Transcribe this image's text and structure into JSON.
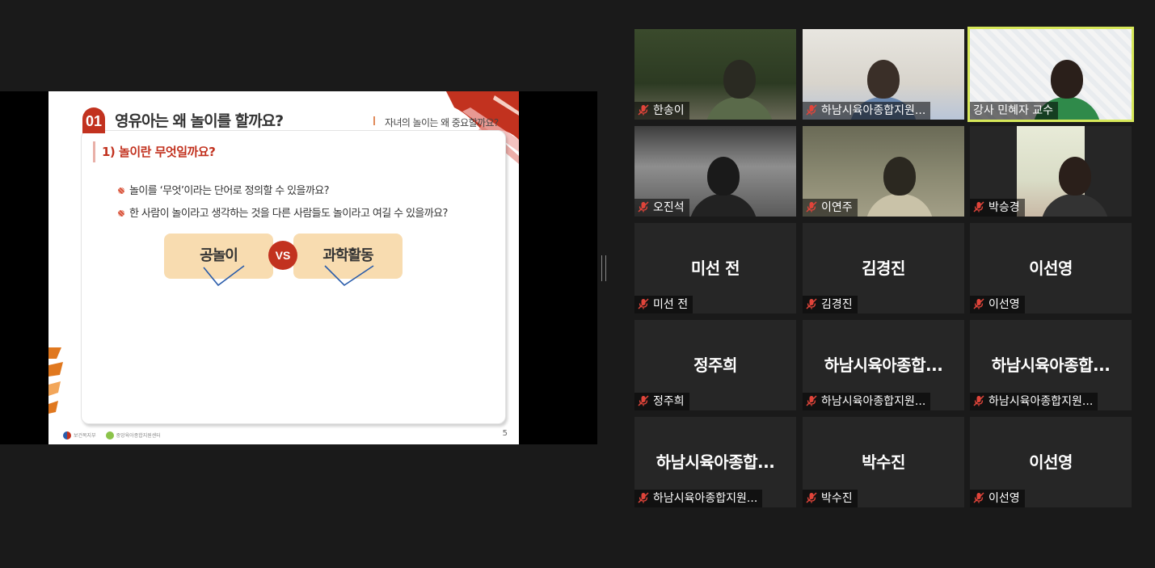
{
  "slide": {
    "number": "01",
    "title": "영유아는 왜 놀이를 할까요?",
    "subtitle": "자녀의 놀이는 왜 중요할까요?",
    "section": "1) 놀이란 무엇일까요?",
    "questions": [
      "놀이를 ‘무엇’이라는 단어로 정의할 수 있을까요?",
      "한 사람이 놀이라고 생각하는 것을 다른 사람들도 놀이라고 여길 수 있을까요?"
    ],
    "compare_left": "공놀이",
    "vs": "VS",
    "compare_right": "과학활동",
    "footer_left": "보건복지부",
    "footer_right": "중앙육아종합지원센터",
    "page": "5"
  },
  "colors": {
    "accent": "#c2321f",
    "pill": "#f8dcb0",
    "active_speaker": "#d7e85a",
    "muted_icon": "#e0443a"
  },
  "participants": [
    {
      "label": "한송이",
      "big": "",
      "video": true,
      "muted": true
    },
    {
      "label": "하남시육아종합지원...",
      "big": "",
      "video": true,
      "muted": true
    },
    {
      "label": "강사 민혜자 교수",
      "big": "",
      "video": true,
      "muted": false,
      "active": true
    },
    {
      "label": "오진석",
      "big": "",
      "video": true,
      "muted": true
    },
    {
      "label": "이연주",
      "big": "",
      "video": true,
      "muted": true
    },
    {
      "label": "박승경",
      "big": "",
      "video": true,
      "muted": true
    },
    {
      "label": "미선 전",
      "big": "미선 전",
      "video": false,
      "muted": true
    },
    {
      "label": "김경진",
      "big": "김경진",
      "video": false,
      "muted": true
    },
    {
      "label": "이선영",
      "big": "이선영",
      "video": false,
      "muted": true
    },
    {
      "label": "정주희",
      "big": "정주희",
      "video": false,
      "muted": true
    },
    {
      "label": "하남시육아종합지원...",
      "big": "하남시육아종합...",
      "video": false,
      "muted": true
    },
    {
      "label": "하남시육아종합지원...",
      "big": "하남시육아종합...",
      "video": false,
      "muted": true
    },
    {
      "label": "하남시육아종합지원...",
      "big": "하남시육아종합...",
      "video": false,
      "muted": true
    },
    {
      "label": "박수진",
      "big": "박수진",
      "video": false,
      "muted": true
    },
    {
      "label": "이선영",
      "big": "이선영",
      "video": false,
      "muted": true
    }
  ]
}
